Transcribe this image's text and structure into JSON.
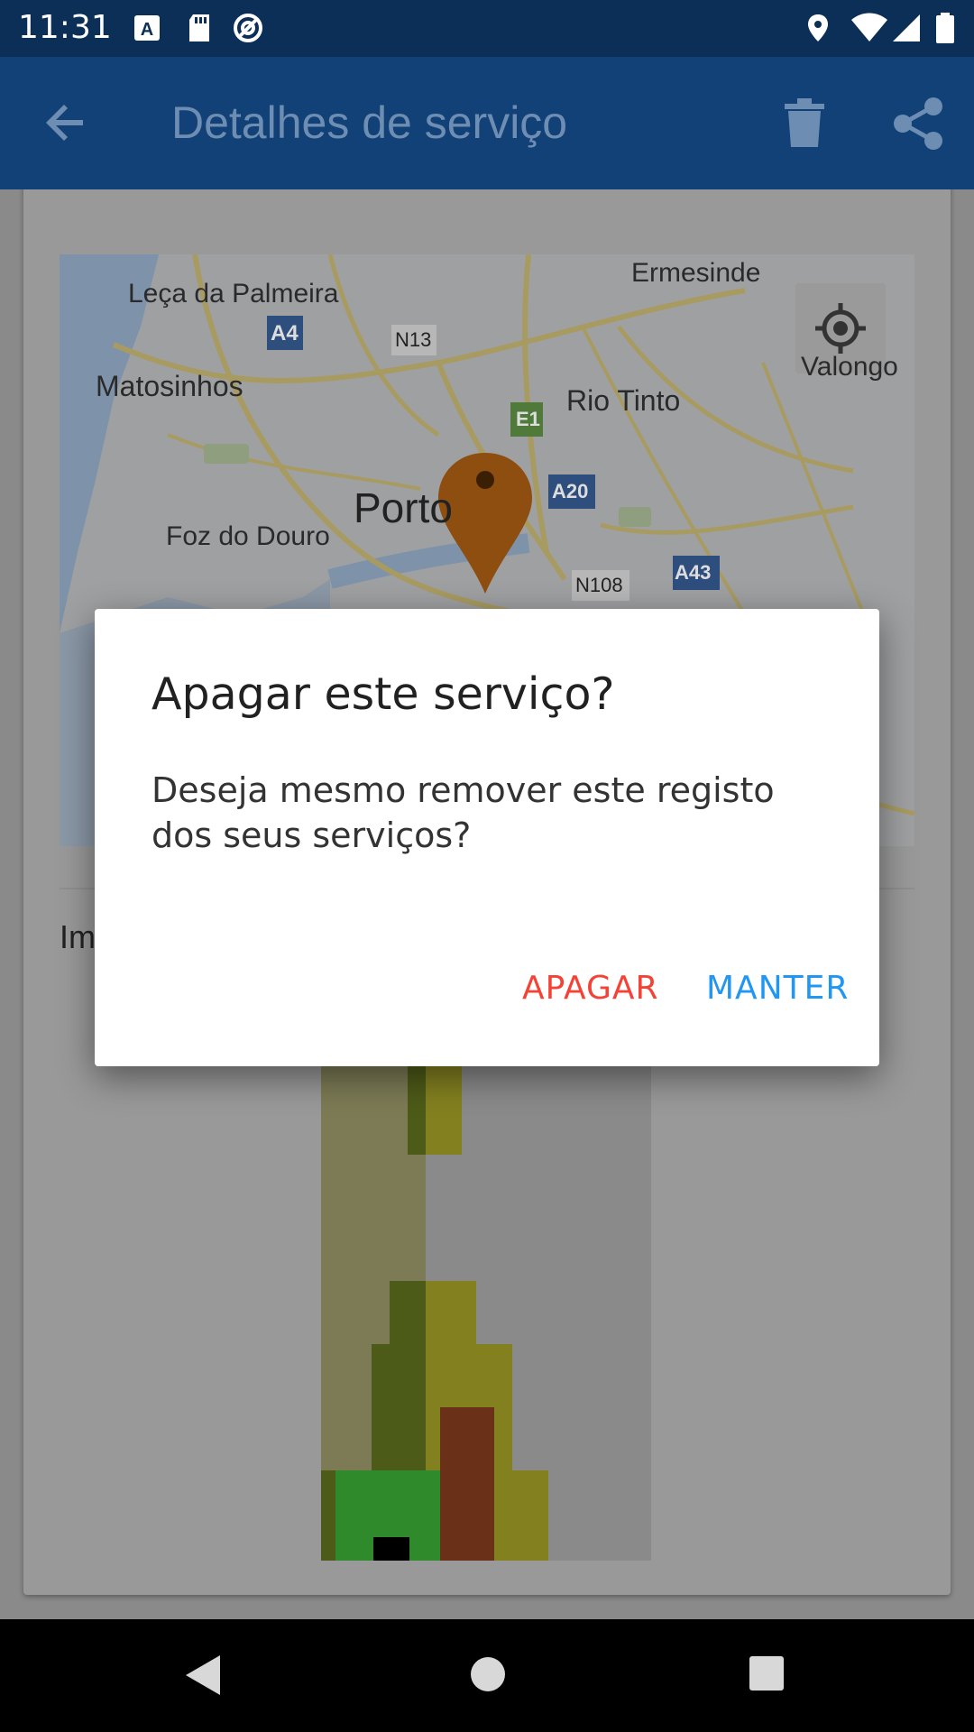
{
  "status_bar": {
    "time": "11:31",
    "icons": [
      "a-notification-icon",
      "sd-card-icon",
      "at-icon",
      "location-icon",
      "wifi-icon",
      "signal-icon",
      "battery-icon"
    ]
  },
  "app_bar": {
    "title": "Detalhes de serviço",
    "back_icon": "arrow-back-icon",
    "delete_icon": "trash-icon",
    "share_icon": "share-icon"
  },
  "map": {
    "labels": [
      "Leça da Palmeira",
      "Matosinhos",
      "A4",
      "N13",
      "Ermesinde",
      "Valongo",
      "E1",
      "Rio Tinto",
      "Porto",
      "A20",
      "Foz do Douro",
      "N108",
      "A43"
    ],
    "marker_icon": "map-pin-icon",
    "locate_icon": "my-location-icon"
  },
  "content": {
    "image_label_partial": "Im"
  },
  "dialog": {
    "title": "Apagar este serviço?",
    "message": "Deseja mesmo remover este registo dos seus serviços?",
    "delete_label": "APAGAR",
    "keep_label": "MANTER",
    "delete_color": "#f44336",
    "keep_color": "#2196f3"
  },
  "colors": {
    "status_bar": "#0b2f57",
    "app_bar": "#114177",
    "scrim_content": "#999999"
  }
}
